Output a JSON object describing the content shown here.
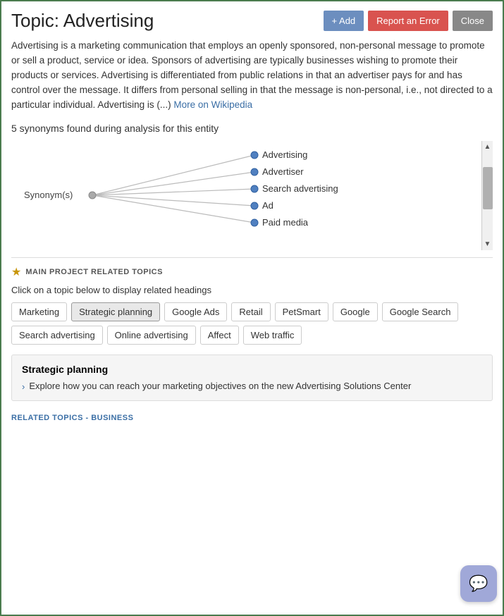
{
  "header": {
    "title": "Topic: Advertising",
    "buttons": {
      "add": "+ Add",
      "report": "Report an Error",
      "close": "Close"
    }
  },
  "description": {
    "text": "Advertising is a marketing communication that employs an openly sponsored, non-personal message to promote or sell a product, service or idea. Sponsors of advertising are typically businesses wishing to promote their products or services. Advertising is differentiated from public relations in that an advertiser pays for and has control over the message. It differs from personal selling in that the message is non-personal, i.e., not directed to a particular individual. Advertising is (...) ",
    "wiki_link_text": "More on Wikipedia",
    "wiki_link_url": "#"
  },
  "synonyms": {
    "header": "5 synonyms found during analysis for this entity",
    "center_label": "Synonym(s)",
    "items": [
      "Advertising",
      "Advertiser",
      "Search advertising",
      "Ad",
      "Paid media"
    ]
  },
  "main_project_related_topics": {
    "label": "MAIN PROJECT RELATED TOPICS",
    "click_hint": "Click on a topic below to display related headings",
    "tags": [
      "Marketing",
      "Strategic planning",
      "Google Ads",
      "Retail",
      "PetSmart",
      "Google",
      "Google Search",
      "Search advertising",
      "Online advertising",
      "Affect",
      "Web traffic"
    ],
    "active_tag": "Strategic planning"
  },
  "topic_detail": {
    "title": "Strategic planning",
    "item": "Explore how you can reach your marketing objectives on the new Advertising Solutions Center"
  },
  "related_business": {
    "label": "RELATED TOPICS - BUSINESS"
  },
  "chat_button": {
    "icon": "💬"
  }
}
